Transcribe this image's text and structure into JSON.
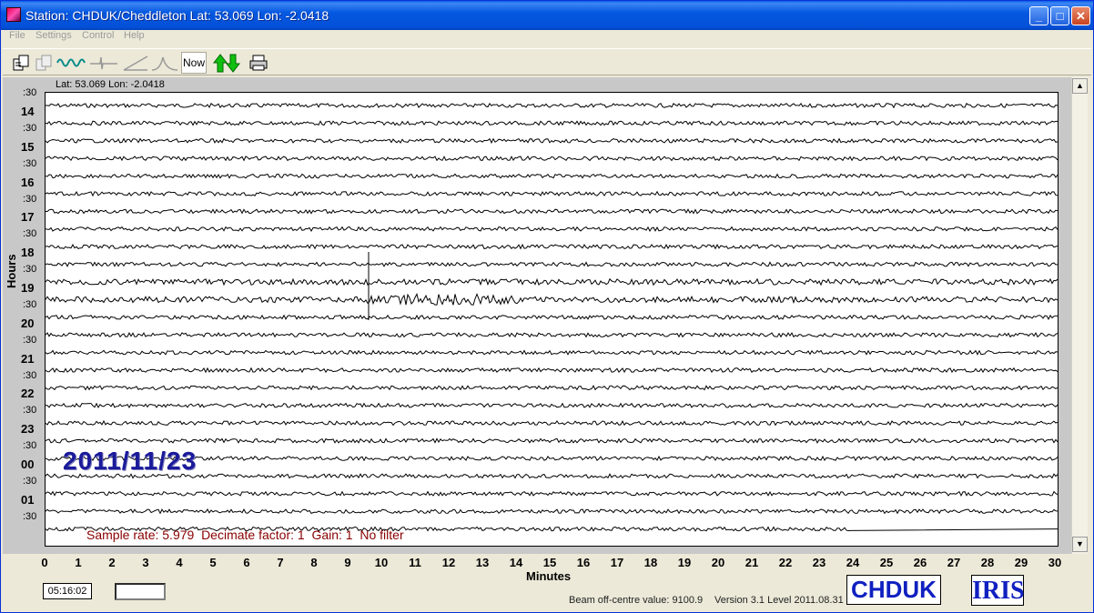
{
  "window": {
    "title": "Station: CHDUK/Cheddleton Lat: 53.069 Lon: -2.0418",
    "min_icon": "minimize-icon",
    "max_icon": "maximize-icon",
    "close_icon": "close-icon"
  },
  "menu": {
    "items": [
      "File",
      "Settings",
      "Control",
      "Help"
    ]
  },
  "toolbar": {
    "icons": [
      "export-icon",
      "copy-icon",
      "waveform-icon",
      "pulse-icon",
      "ramp-icon",
      "bell-curve-icon"
    ],
    "now_label": "Now",
    "arrows_icon": "up-down-arrows-icon",
    "print_icon": "printer-icon"
  },
  "chart": {
    "latlon": "Lat: 53.069 Lon: -2.0418",
    "yaxis_title": "Hours",
    "hour_labels": [
      "14",
      "15",
      "16",
      "17",
      "18",
      "19",
      "20",
      "21",
      "22",
      "23",
      "00",
      "01"
    ],
    "half_label": ":30",
    "xaxis_title": "Minutes",
    "x_ticks": [
      "0",
      "1",
      "2",
      "3",
      "4",
      "5",
      "6",
      "7",
      "8",
      "9",
      "10",
      "11",
      "12",
      "13",
      "14",
      "15",
      "16",
      "17",
      "18",
      "19",
      "20",
      "21",
      "22",
      "23",
      "24",
      "25",
      "26",
      "27",
      "28",
      "29",
      "30"
    ],
    "date": "2011/11/23",
    "info": "Sample rate: 5.979  Decimate factor: 1  Gain: 1  No filter"
  },
  "footer": {
    "time": "05:16:02",
    "beam": "Beam off-centre value: 9100.9",
    "version": "Version 3.1 Level 2011.08.31",
    "station_logo": "CHDUK",
    "iris_logo": "IRIS"
  },
  "colors": {
    "title_bar": "#0558e0",
    "info_text": "#8a0000",
    "date_text": "#1a1a9a",
    "logo_blue": "#1020c0"
  }
}
